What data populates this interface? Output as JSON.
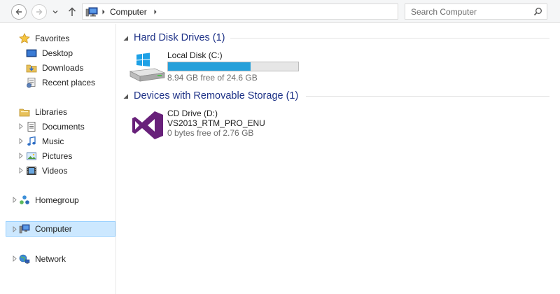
{
  "address": {
    "location": "Computer"
  },
  "search": {
    "placeholder": "Search Computer"
  },
  "navpane": {
    "favorites": {
      "label": "Favorites",
      "items": [
        "Desktop",
        "Downloads",
        "Recent places"
      ]
    },
    "libraries": {
      "label": "Libraries",
      "items": [
        "Documents",
        "Music",
        "Pictures",
        "Videos"
      ]
    },
    "homegroup": "Homegroup",
    "computer": "Computer",
    "network": "Network"
  },
  "groups": [
    {
      "title": "Hard Disk Drives (1)",
      "drives": [
        {
          "name": "Local Disk (C:)",
          "free_text": "8.94 GB free of 24.6 GB",
          "used_fraction": 0.637
        }
      ]
    },
    {
      "title": "Devices with Removable Storage (1)",
      "drives": [
        {
          "name": "CD Drive (D:)",
          "volume": "VS2013_RTM_PRO_ENU",
          "free_text": "0 bytes free of 2.76 GB"
        }
      ]
    }
  ],
  "colors": {
    "accent": "#26a0da",
    "group_title": "#1e3287",
    "selection": "#cce8ff",
    "vs_logo": "#68217a"
  }
}
